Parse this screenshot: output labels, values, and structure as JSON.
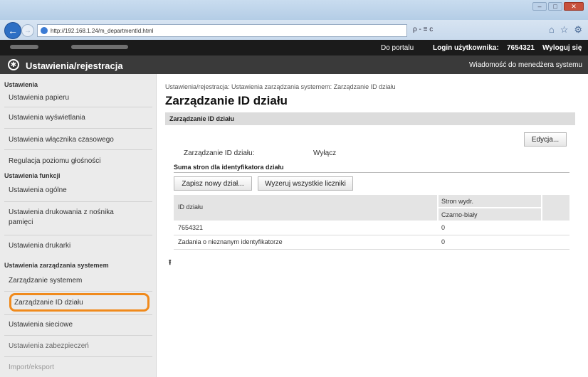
{
  "browser": {
    "address": "http://192.168.1.24/m_departmentId.html",
    "search_glyph": "ρ - ≡ c"
  },
  "topbar": {
    "portal_link": "Do portalu",
    "login_label": "Login użytkownika:",
    "login_value": "7654321",
    "logout_link": "Wyloguj się"
  },
  "header": {
    "title": "Ustawienia/rejestracja",
    "message_link": "Wiadomość do menedżera systemu"
  },
  "sidebar": {
    "sections": [
      {
        "heading": "Ustawienia"
      },
      {
        "heading": "Ustawienia funkcji"
      },
      {
        "heading": "Ustawienia zarządzania systemem"
      }
    ],
    "items": [
      {
        "label": "Ustawienia papieru"
      },
      {
        "label": "Ustawienia wyświetlania"
      },
      {
        "label": "Ustawienia włącznika czasowego"
      },
      {
        "label": "Regulacja poziomu głośności"
      },
      {
        "label": "Ustawienia ogólne"
      },
      {
        "label": "Ustawienia drukowania z nośnika pamięci"
      },
      {
        "label": "Ustawienia drukarki"
      },
      {
        "label": "Zarządzanie systemem"
      },
      {
        "label": "Zarządzanie ID działu"
      },
      {
        "label": "Ustawienia sieciowe"
      },
      {
        "label": "Ustawienia zabezpieczeń"
      },
      {
        "label": "Import/eksport"
      }
    ]
  },
  "main": {
    "breadcrumb": "Ustawienia/rejestracja: Ustawienia zarządzania systemem: Zarządzanie ID działu",
    "title": "Zarządzanie ID działu",
    "section_title": "Zarządzanie ID działu",
    "edit_button": "Edycja...",
    "dept_mgmt_label": "Zarządzanie ID działu:",
    "dept_mgmt_value": "Wyłącz",
    "pages_heading": "Suma stron dla identyfikatora działu",
    "register_button": "Zapisz nowy dział...",
    "reset_button": "Wyzeruj wszystkie liczniki",
    "table": {
      "col_id": "ID działu",
      "col_pages": "Stron wydr.",
      "col_bw": "Czarno-biały",
      "rows": [
        {
          "id": "7654321",
          "value": "0"
        },
        {
          "id": "Zadania o nieznanym identyfikatorze",
          "value": "0"
        }
      ]
    },
    "top_glyph": "⭱"
  },
  "colors": {
    "highlight": "#f08a1c",
    "topbar": "#1b1b1b",
    "header": "#3a3a3a"
  }
}
